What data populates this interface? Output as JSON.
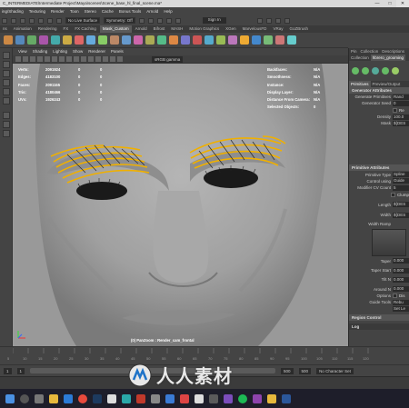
{
  "window": {
    "title": "C_INTERMEDIATE\\Intermediate Project\\Maya\\scenes\\Scene_base_hl_final_scene.ma*",
    "btn_min": "—",
    "btn_max": "□",
    "btn_close": "✕"
  },
  "menu": [
    "ing/Shading",
    "Texturing",
    "Render",
    "Toon",
    "Stereo",
    "Cache",
    "Bonus Tools",
    "Arnold",
    "Help"
  ],
  "status": {
    "no_live_surface": "No Live Surface",
    "symmetry": "Symmetry: Off",
    "sign_in": "Sign In"
  },
  "shelf_tabs": [
    "ns",
    "Animation",
    "Rendering",
    "FX",
    "FX Caching",
    "Mask_Custom",
    "Arnold",
    "Bifrost",
    "MASH",
    "Motion Graphics",
    "XGen",
    "MarvelousFD",
    "VRay",
    "GoZBrush"
  ],
  "shelf_active": "Mask_Custom",
  "viewport_menu": [
    "View",
    "Shading",
    "Lighting",
    "Show",
    "Renderer",
    "Panels"
  ],
  "colorspace": "sRGB gamma",
  "hud_left": {
    "labels": [
      "Verts:",
      "Edges:",
      "Faces:",
      "Tris:",
      "UVs:"
    ],
    "col1": [
      "2091924",
      "4183100",
      "2091165",
      "4180466",
      "1926243"
    ],
    "col2": [
      "0",
      "0",
      "0",
      "0",
      "0"
    ],
    "col3": [
      "0",
      "0",
      "0",
      "0",
      "0"
    ]
  },
  "hud_right": {
    "labels": [
      "Backfaces:",
      "Smoothness:",
      "Instance:",
      "Display Layer:",
      "Distance From Camera:",
      "Selected Objects:"
    ],
    "values": [
      "N/A",
      "N/A",
      "N/A",
      "N/A",
      "N/A",
      "0"
    ]
  },
  "camera_label": "(0) PanZoom : Render_cam_frontal",
  "right_tabs": [
    "Pin",
    "Collection",
    "Descriptions"
  ],
  "right_sub": [
    "Collection",
    "hbrero_grooming"
  ],
  "editor_tabs": [
    "Primitives",
    "Preview/Output"
  ],
  "gen_attr": {
    "title": "Generator Attributes",
    "rows": [
      {
        "label": "Generate Primitives",
        "value": "Rand"
      },
      {
        "label": "Generator Seed",
        "value": "0"
      },
      {
        "label": "",
        "value": "Re"
      },
      {
        "label": "Density",
        "value": "100.0"
      },
      {
        "label": "Mask",
        "value": "${DES"
      }
    ]
  },
  "prim_attr": {
    "title": "Primitive Attributes",
    "rows": [
      {
        "label": "Primitive Type",
        "value": "Spline"
      },
      {
        "label": "Control using",
        "value": "Guide"
      },
      {
        "label": "Modifier CV Count",
        "value": "5"
      },
      {
        "label": "",
        "value": "Clump"
      },
      {
        "label": "Length",
        "value": "${DES"
      },
      {
        "label": "Width",
        "value": "${DES"
      },
      {
        "label": "Width Ramp",
        "value": ""
      },
      {
        "label": "Taper",
        "value": "0.000"
      },
      {
        "label": "Taper Start",
        "value": "0.000"
      },
      {
        "label": "Tilt N",
        "value": "0.000"
      },
      {
        "label": "Around N",
        "value": "0.000"
      },
      {
        "label": "Options",
        "value": "Dis"
      },
      {
        "label": "Guide Tools",
        "value": "Rebu"
      },
      {
        "label": "",
        "value": "Set Le"
      }
    ]
  },
  "region_control": "Region Control",
  "log": "Log",
  "timeline_ticks": [
    "5",
    "10",
    "15",
    "20",
    "25",
    "30",
    "35",
    "40",
    "45",
    "50",
    "55",
    "60",
    "65",
    "70",
    "75",
    "80",
    "85",
    "90",
    "95",
    "100",
    "105",
    "110",
    "115",
    "120"
  ],
  "range": {
    "start": "1",
    "inner_start": "1",
    "end": "500",
    "outer_end": "500",
    "char_set": "No Character Set"
  },
  "watermark": "人人素材",
  "colors": {
    "viewport_bg": "#9a9a9a",
    "eyebrow_guides": "#f0b000",
    "ui_bg": "#444444",
    "taskbar": "#1e1e2a",
    "active_tab": "#5b5b5b"
  },
  "taskbar_icons": [
    "windows-icon",
    "search-icon",
    "task-view-icon",
    "folder-icon",
    "store-icon",
    "chrome-icon",
    "photoshop-icon",
    "k-icon",
    "maya-icon",
    "substance-icon",
    "zbrush-icon",
    "marvelous-icon",
    "mail-icon",
    "media-icon",
    "calc-icon",
    "ps2-icon",
    "spotify-icon",
    "pr-icon",
    "folder2-icon",
    "word-icon"
  ]
}
